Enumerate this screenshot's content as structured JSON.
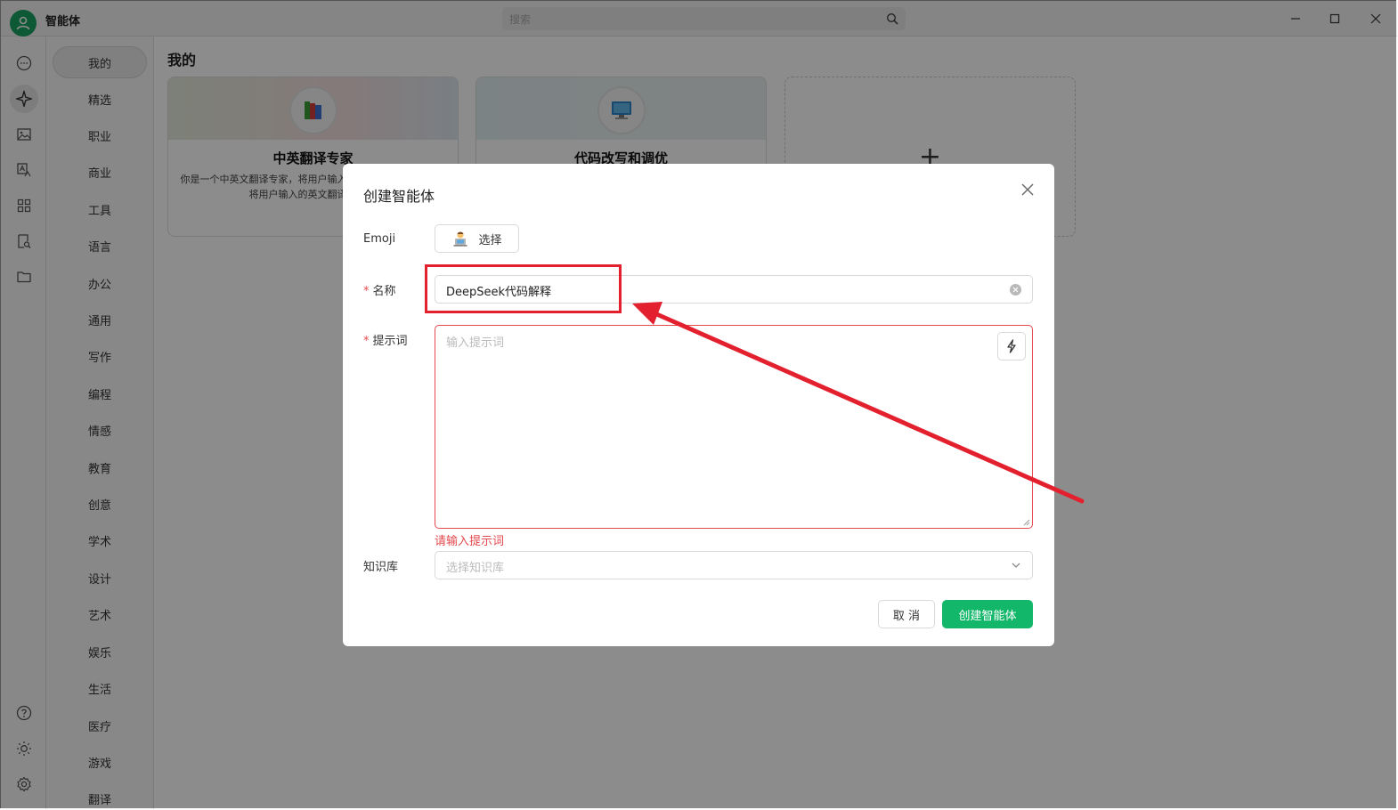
{
  "app": {
    "title": "智能体",
    "search_placeholder": "搜索"
  },
  "rail": {
    "icons": [
      "chat-icon",
      "agent-sparkle-icon",
      "image-icon",
      "translate-icon",
      "apps-grid-icon",
      "document-search-icon",
      "folder-icon",
      "help-icon",
      "theme-sun-icon",
      "settings-gear-icon"
    ],
    "active": "agent-sparkle-icon"
  },
  "categories": {
    "items": [
      "我的",
      "精选",
      "职业",
      "商业",
      "工具",
      "语言",
      "办公",
      "通用",
      "写作",
      "编程",
      "情感",
      "教育",
      "创意",
      "学术",
      "设计",
      "艺术",
      "娱乐",
      "生活",
      "医疗",
      "游戏",
      "翻译"
    ],
    "active": "我的"
  },
  "main": {
    "title": "我的",
    "cards": [
      {
        "name": "中英翻译专家",
        "desc": "你是一个中英文翻译专家，将用户输入的中文翻译成英文，或将用户输入的英文翻译成中文",
        "emoji": "books-emoji"
      },
      {
        "name": "代码改写和调优",
        "desc": "",
        "emoji": "computer-emoji"
      }
    ],
    "add_label": "+"
  },
  "dialog": {
    "title": "创建智能体",
    "emoji_label": "Emoji",
    "emoji_button": "选择",
    "required_mark": "*",
    "name_label": "名称",
    "name_value": "DeepSeek代码解释",
    "prompt_label": "提示词",
    "prompt_placeholder": "输入提示词",
    "prompt_error": "请输入提示词",
    "kb_label": "知识库",
    "kb_placeholder": "选择知识库",
    "cancel_label": "取 消",
    "create_label": "创建智能体"
  },
  "colors": {
    "accent": "#12b76a",
    "error": "#e5484d",
    "annotation": "#e3202e"
  }
}
